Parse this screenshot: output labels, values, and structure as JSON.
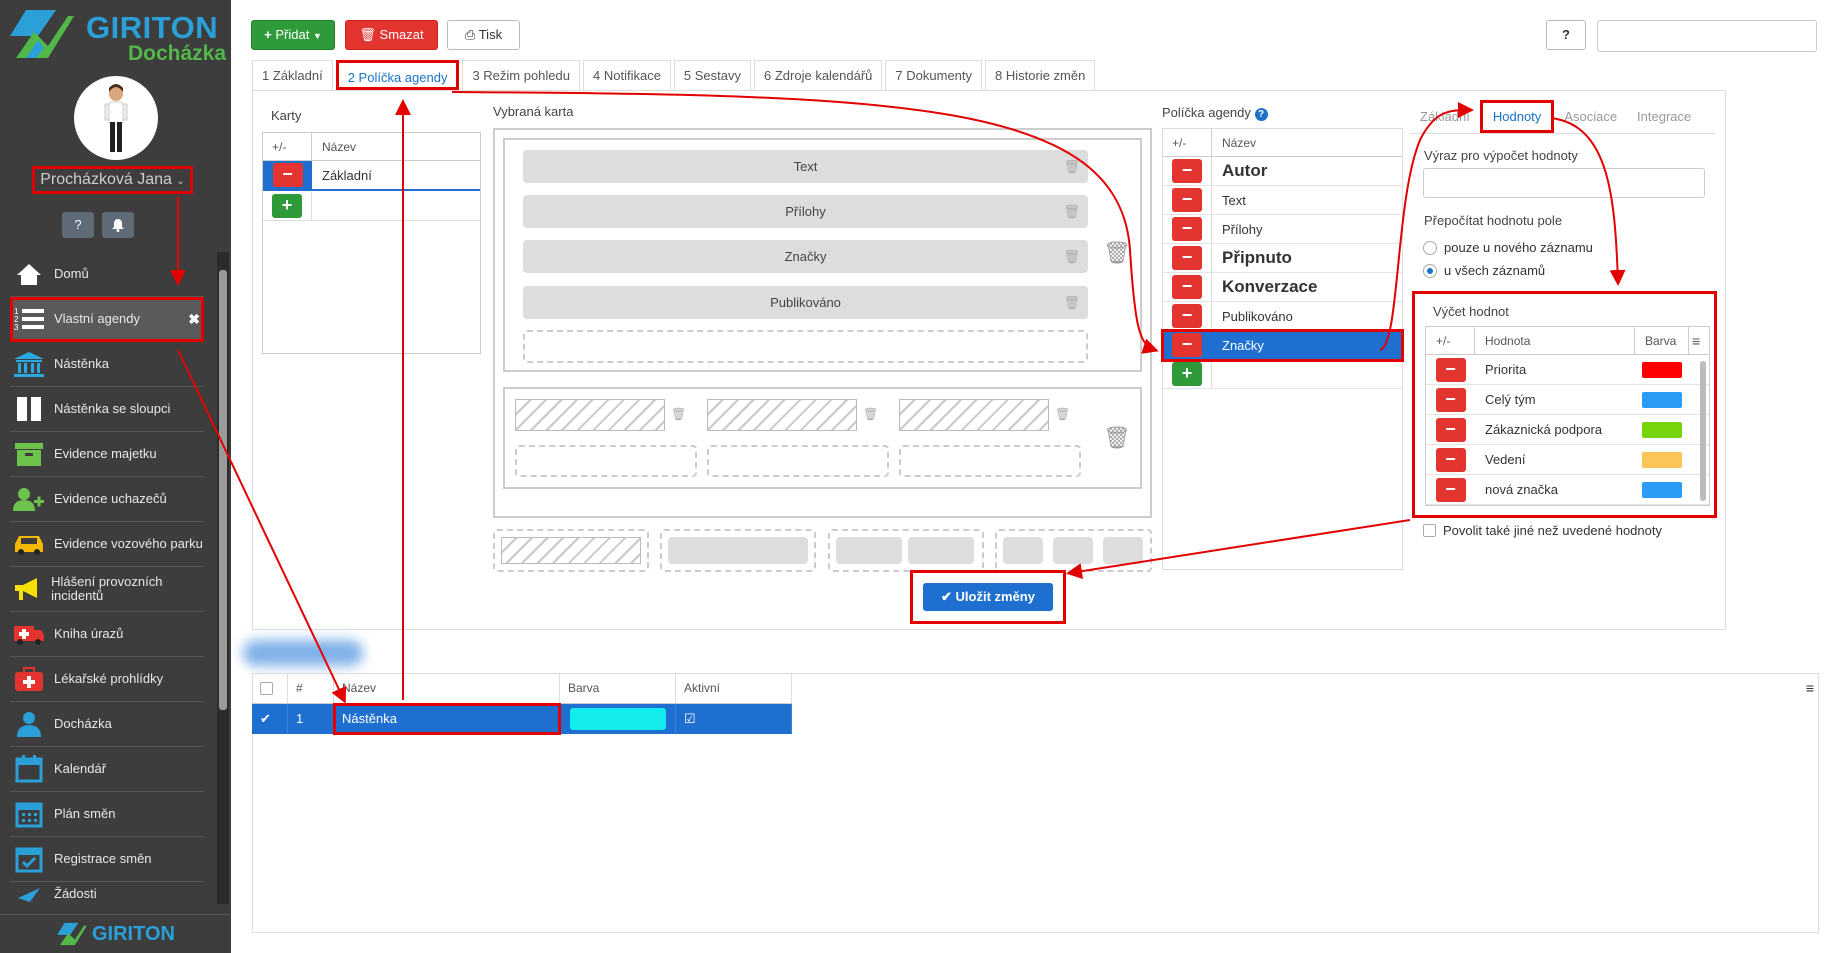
{
  "brand": {
    "title": "GIRITON",
    "subtitle": "Docházka",
    "footer": "GIRITON"
  },
  "user": {
    "name": "Procházková Jana"
  },
  "sidebar": {
    "items": [
      {
        "label": "Domů",
        "icon": "home-icon"
      },
      {
        "label": "Vlastní agendy",
        "icon": "numbered-list-icon",
        "active": true
      },
      {
        "label": "Nástěnka",
        "icon": "institution-icon"
      },
      {
        "label": "Nástěnka se sloupci",
        "icon": "columns-icon"
      },
      {
        "label": "Evidence majetku",
        "icon": "archive-icon"
      },
      {
        "label": "Evidence uchazečů",
        "icon": "user-plus-icon"
      },
      {
        "label": "Evidence vozového parku",
        "icon": "car-icon"
      },
      {
        "label": "Hlášení provozních incidentů",
        "icon": "megaphone-icon"
      },
      {
        "label": "Kniha úrazů",
        "icon": "ambulance-icon"
      },
      {
        "label": "Lékařské prohlídky",
        "icon": "medkit-icon"
      },
      {
        "label": "Docházka",
        "icon": "user-icon"
      },
      {
        "label": "Kalendář",
        "icon": "calendar-icon"
      },
      {
        "label": "Plán směn",
        "icon": "calendar-grid-icon"
      },
      {
        "label": "Registrace směn",
        "icon": "calendar-check-icon"
      },
      {
        "label": "Žádosti",
        "icon": "plane-icon"
      }
    ]
  },
  "toolbar": {
    "add": "Přidat",
    "delete": "Smazat",
    "print": "Tisk",
    "help": "?"
  },
  "tabs": [
    "1 Základní",
    "2 Políčka agendy",
    "3 Režim pohledu",
    "4 Notifikace",
    "5 Sestavy",
    "6 Zdroje kalendářů",
    "7 Dokumenty",
    "8 Historie změn"
  ],
  "karty": {
    "label": "Karty",
    "col_pm": "+/-",
    "col_name": "Název",
    "rows": [
      "Základní"
    ]
  },
  "vybrana_karta": {
    "label": "Vybraná karta",
    "fields": [
      "Text",
      "Přílohy",
      "Značky",
      "Publikováno"
    ]
  },
  "policka": {
    "label": "Políčka agendy",
    "col_pm": "+/-",
    "col_name": "Název",
    "rows": [
      {
        "name": "Autor",
        "bold": true
      },
      {
        "name": "Text",
        "bold": false
      },
      {
        "name": "Přílohy",
        "bold": false
      },
      {
        "name": "Připnuto",
        "bold": true
      },
      {
        "name": "Konverzace",
        "bold": true
      },
      {
        "name": "Publikováno",
        "bold": false
      },
      {
        "name": "Značky",
        "bold": false,
        "selected": true
      }
    ]
  },
  "right_panel": {
    "subtabs": [
      "Základní",
      "Hodnoty",
      "Asociace",
      "Integrace"
    ],
    "expr_label": "Výraz pro výpočet hodnoty",
    "recalc_label": "Přepočítat hodnotu pole",
    "radio_new": "pouze u nového záznamu",
    "radio_all": "u všech záznamů",
    "vycet_label": "Výčet hodnot",
    "col_pm": "+/-",
    "col_value": "Hodnota",
    "col_color": "Barva",
    "values": [
      {
        "name": "Priorita",
        "color": "#ff0000"
      },
      {
        "name": "Celý tým",
        "color": "#2b9cf5"
      },
      {
        "name": "Zákaznická podpora",
        "color": "#77d40a"
      },
      {
        "name": "Vedení",
        "color": "#fbc55a"
      },
      {
        "name": "nová značka",
        "color": "#2b9cf5"
      }
    ],
    "allow_other": "Povolit také jiné než uvedené hodnoty"
  },
  "save_button": "Uložit změny",
  "bottom_grid": {
    "cols": [
      "#",
      "Název",
      "Barva",
      "Aktivní"
    ],
    "rows": [
      {
        "num": "1",
        "name": "Nástěnka",
        "color": "#12ecec",
        "active": "☑"
      }
    ]
  },
  "colors": {
    "accent": "#1e6fd0",
    "danger": "#e3342f",
    "success": "#2f9a3a",
    "annotation": "#e30000"
  }
}
